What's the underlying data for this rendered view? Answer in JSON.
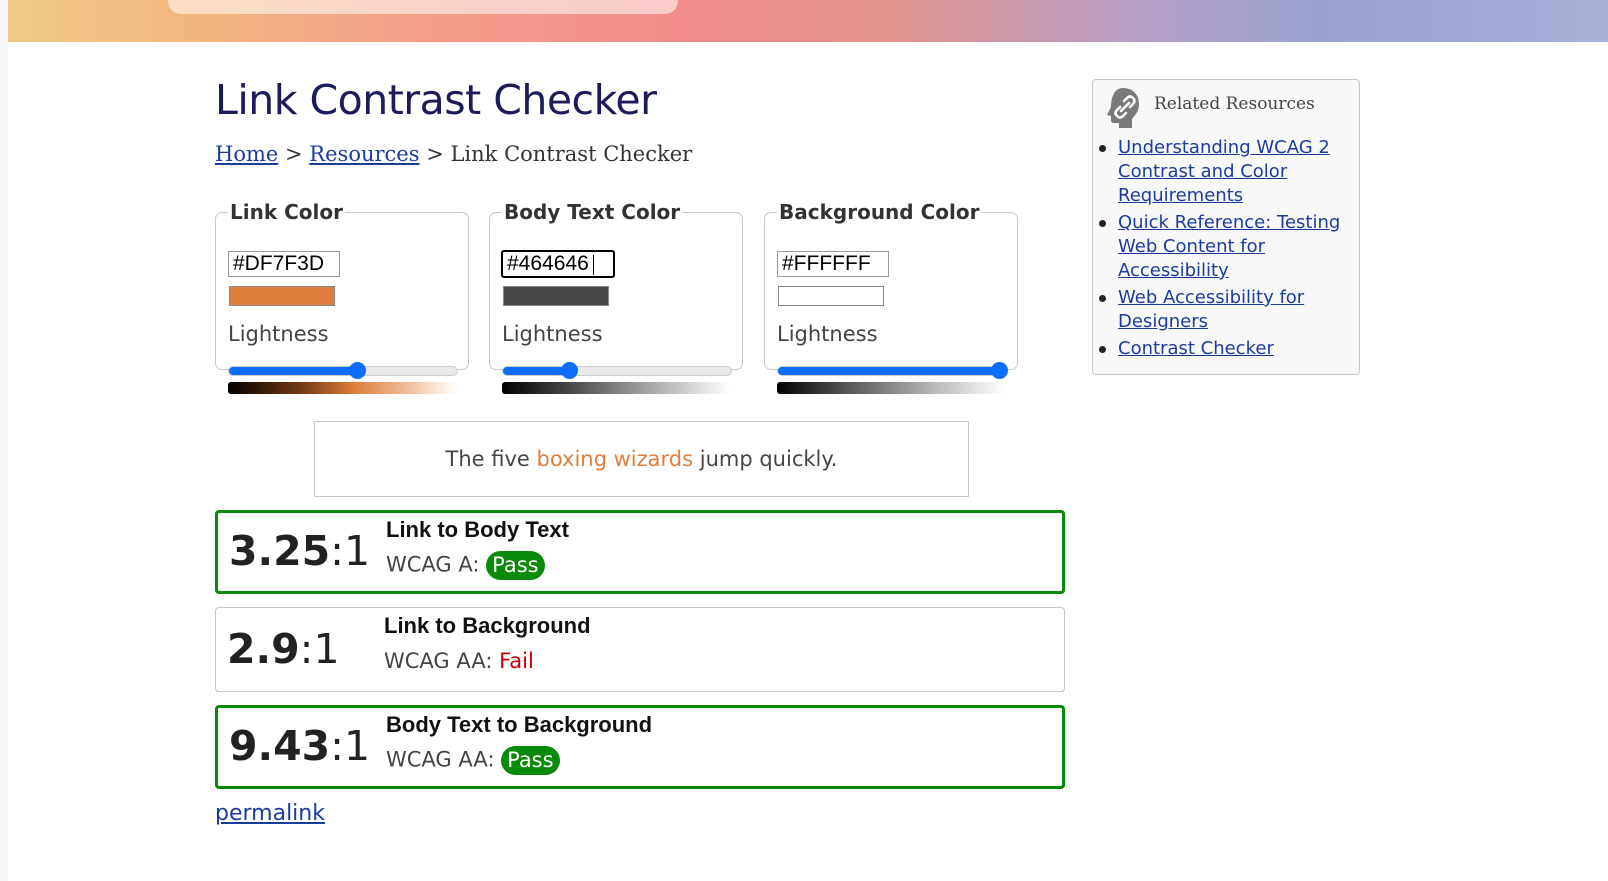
{
  "header": {
    "title": "Link Contrast Checker",
    "breadcrumb": {
      "home": "Home",
      "sep1": ">",
      "resources": "Resources",
      "sep2": ">",
      "current": "Link Contrast Checker"
    }
  },
  "pickers": {
    "link": {
      "legend": "Link Color",
      "hex": "#DF7F3D",
      "swatch_color": "#df7f3d",
      "lightness_label": "Lightness",
      "lightness": 0.56
    },
    "body": {
      "legend": "Body Text Color",
      "hex": "#464646",
      "swatch_color": "#464646",
      "lightness_label": "Lightness",
      "lightness": 0.29
    },
    "background": {
      "legend": "Background Color",
      "hex": "#FFFFFF",
      "swatch_color": "#ffffff",
      "lightness_label": "Lightness",
      "lightness": 0.97
    }
  },
  "sample": {
    "before": "The five ",
    "link": "boxing wizards",
    "after": " jump quickly."
  },
  "results": [
    {
      "ratio": "3.25",
      "suffix": ":1",
      "title": "Link to Body Text",
      "level": "WCAG A:",
      "status": "Pass"
    },
    {
      "ratio": "2.9",
      "suffix": ":1",
      "title": "Link to Background",
      "level": "WCAG AA:",
      "status": "Fail"
    },
    {
      "ratio": "9.43",
      "suffix": ":1",
      "title": "Body Text to Background",
      "level": "WCAG AA:",
      "status": "Pass"
    }
  ],
  "permalink": "permalink",
  "sidebar": {
    "title": "Related Resources",
    "icon": "link-icon",
    "links": [
      "Understanding WCAG 2 Contrast and Color Requirements",
      "Quick Reference: Testing Web Content for Accessibility",
      "Web Accessibility for Designers",
      "Contrast Checker"
    ]
  },
  "colors": {
    "accent_blue": "#0d6efd",
    "pass_green": "#0a8a0a",
    "fail_red": "#cc0000",
    "title_navy": "#1c1c5c",
    "link_blue": "#1c3c9c"
  }
}
